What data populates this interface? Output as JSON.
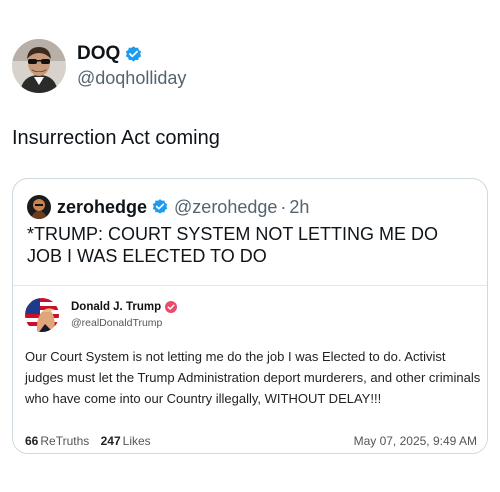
{
  "post": {
    "display_name": "DOQ",
    "handle": "@doqholliday",
    "text": "Insurrection Act coming"
  },
  "quote": {
    "display_name": "zerohedge",
    "handle": "@zerohedge",
    "separator": "·",
    "time": "2h",
    "text": "*TRUMP: COURT SYSTEM NOT LETTING ME DO JOB I WAS ELECTED TO DO"
  },
  "embed": {
    "display_name": "Donald J. Trump",
    "handle": "@realDonaldTrump",
    "text": "Our Court System is not letting me do the job I was Elected to do. Activist judges must let the Trump Administration deport murderers, and other criminals who have come into our Country illegally, WITHOUT DELAY!!!",
    "retruths_count": "66",
    "retruths_label": "ReTruths",
    "likes_count": "247",
    "likes_label": "Likes",
    "timestamp": "May 07, 2025, 9:49 AM"
  },
  "colors": {
    "verified_blue": "#1d9bf0",
    "truth_badge": "#e94b6d",
    "secondary_text": "#536471",
    "card_border": "#cfd9de"
  },
  "icons": {
    "post_avatar": "avatar-man-sunglasses",
    "verified": "verified-badge-icon",
    "quote_avatar": "avatar-zerohedge",
    "embed_avatar": "avatar-flag-portrait",
    "embed_verified": "truth-verified-badge-icon"
  }
}
